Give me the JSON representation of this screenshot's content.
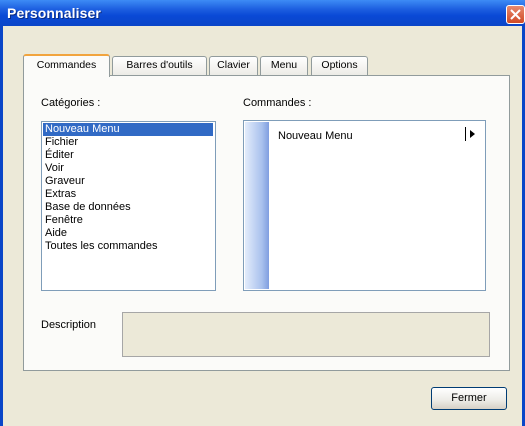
{
  "window": {
    "title": "Personnaliser"
  },
  "tabs": [
    {
      "label": "Commandes",
      "active": true
    },
    {
      "label": "Barres d'outils",
      "active": false
    },
    {
      "label": "Clavier",
      "active": false
    },
    {
      "label": "Menu",
      "active": false
    },
    {
      "label": "Options",
      "active": false
    }
  ],
  "categories": {
    "label": "Catégories :",
    "items": [
      "Nouveau Menu",
      "Fichier",
      "Éditer",
      "Voir",
      "Graveur",
      "Extras",
      "Base de données",
      "Fenêtre",
      "Aide",
      "Toutes les commandes"
    ],
    "selected": "Nouveau Menu"
  },
  "commands": {
    "label": "Commandes :",
    "items": [
      "Nouveau Menu"
    ]
  },
  "description": {
    "label": "Description"
  },
  "buttons": {
    "close": "Fermer"
  },
  "colors": {
    "titlebar": "#0a49d6",
    "selection": "#316ac5",
    "active_tab_accent": "#f1a43e"
  }
}
